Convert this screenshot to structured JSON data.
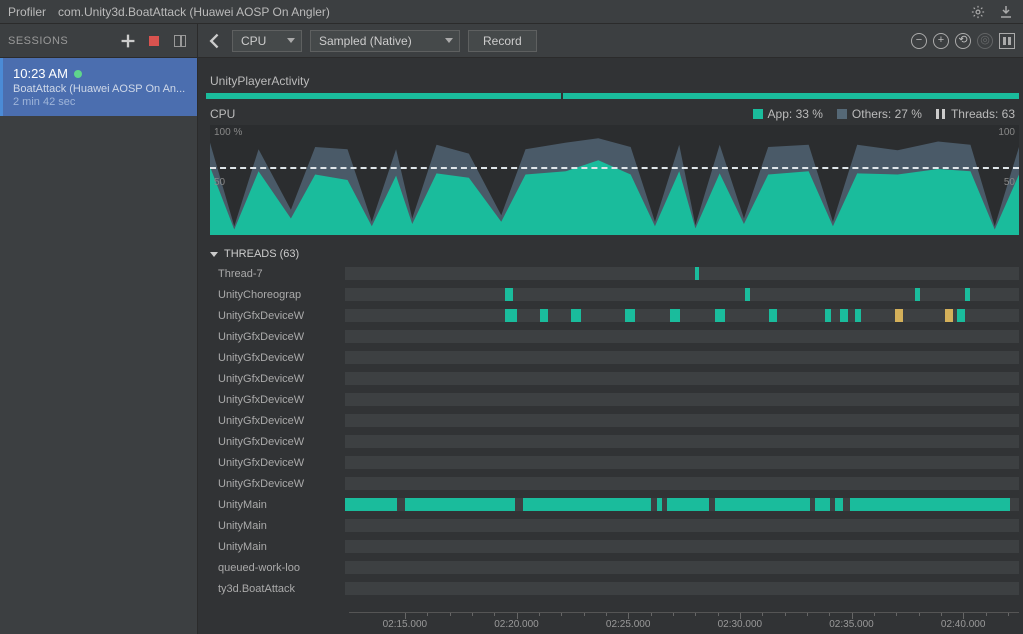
{
  "title_bar": {
    "app": "Profiler",
    "target": "com.Unity3d.BoatAttack (Huawei AOSP On Angler)"
  },
  "sidebar": {
    "header": "SESSIONS",
    "session": {
      "time": "10:23 AM",
      "name": "BoatAttack (Huawei AOSP On An...",
      "duration": "2 min 42 sec"
    }
  },
  "toolbar": {
    "category": "CPU",
    "sample_mode": "Sampled (Native)",
    "record": "Record"
  },
  "activity": "UnityPlayerActivity",
  "cpu": {
    "title": "CPU",
    "legend": {
      "app": "App: 33 %",
      "others": "Others: 27 %",
      "threads": "Threads: 63"
    },
    "y_top": "100 %",
    "y_mid": "50",
    "y_top_r": "100",
    "y_mid_r": "50"
  },
  "threads": {
    "header": "THREADS (63)",
    "names": [
      "Thread-7",
      "UnityChoreograp",
      "UnityGfxDeviceW",
      "UnityGfxDeviceW",
      "UnityGfxDeviceW",
      "UnityGfxDeviceW",
      "UnityGfxDeviceW",
      "UnityGfxDeviceW",
      "UnityGfxDeviceW",
      "UnityGfxDeviceW",
      "UnityGfxDeviceW",
      "UnityMain",
      "UnityMain",
      "UnityMain",
      "queued-work-loo",
      "ty3d.BoatAttack"
    ]
  },
  "timeline": {
    "ticks": [
      "02:15.000",
      "02:20.000",
      "02:25.000",
      "02:30.000",
      "02:35.000",
      "02:40.000"
    ]
  },
  "chart_data": {
    "type": "area",
    "title": "CPU",
    "ylim": [
      0,
      100
    ],
    "ylabel": "%",
    "x_range": [
      "02:15.000",
      "02:40.000"
    ],
    "series": [
      {
        "name": "App",
        "color": "#1abc9c",
        "avg": 33
      },
      {
        "name": "Others",
        "color": "#556876",
        "avg": 27
      }
    ],
    "threads_count": 63,
    "threshold_line": 60,
    "samples": [
      {
        "t": 0.0,
        "app": 62,
        "others": 22
      },
      {
        "t": 0.03,
        "app": 5,
        "others": 3
      },
      {
        "t": 0.06,
        "app": 58,
        "others": 20
      },
      {
        "t": 0.1,
        "app": 15,
        "others": 8
      },
      {
        "t": 0.13,
        "app": 55,
        "others": 25
      },
      {
        "t": 0.17,
        "app": 50,
        "others": 28
      },
      {
        "t": 0.2,
        "app": 8,
        "others": 4
      },
      {
        "t": 0.23,
        "app": 54,
        "others": 24
      },
      {
        "t": 0.25,
        "app": 10,
        "others": 5
      },
      {
        "t": 0.28,
        "app": 56,
        "others": 26
      },
      {
        "t": 0.32,
        "app": 52,
        "others": 22
      },
      {
        "t": 0.36,
        "app": 12,
        "others": 6
      },
      {
        "t": 0.39,
        "app": 55,
        "others": 23
      },
      {
        "t": 0.44,
        "app": 58,
        "others": 26
      },
      {
        "t": 0.48,
        "app": 68,
        "others": 20
      },
      {
        "t": 0.52,
        "app": 55,
        "others": 25
      },
      {
        "t": 0.55,
        "app": 8,
        "others": 4
      },
      {
        "t": 0.58,
        "app": 58,
        "others": 24
      },
      {
        "t": 0.6,
        "app": 6,
        "others": 3
      },
      {
        "t": 0.63,
        "app": 56,
        "others": 26
      },
      {
        "t": 0.66,
        "app": 10,
        "others": 5
      },
      {
        "t": 0.69,
        "app": 55,
        "others": 25
      },
      {
        "t": 0.74,
        "app": 58,
        "others": 24
      },
      {
        "t": 0.77,
        "app": 8,
        "others": 4
      },
      {
        "t": 0.8,
        "app": 56,
        "others": 26
      },
      {
        "t": 0.85,
        "app": 55,
        "others": 22
      },
      {
        "t": 0.9,
        "app": 60,
        "others": 25
      },
      {
        "t": 0.94,
        "app": 58,
        "others": 24
      },
      {
        "t": 0.97,
        "app": 5,
        "others": 3
      },
      {
        "t": 1.0,
        "app": 55,
        "others": 25
      }
    ]
  }
}
